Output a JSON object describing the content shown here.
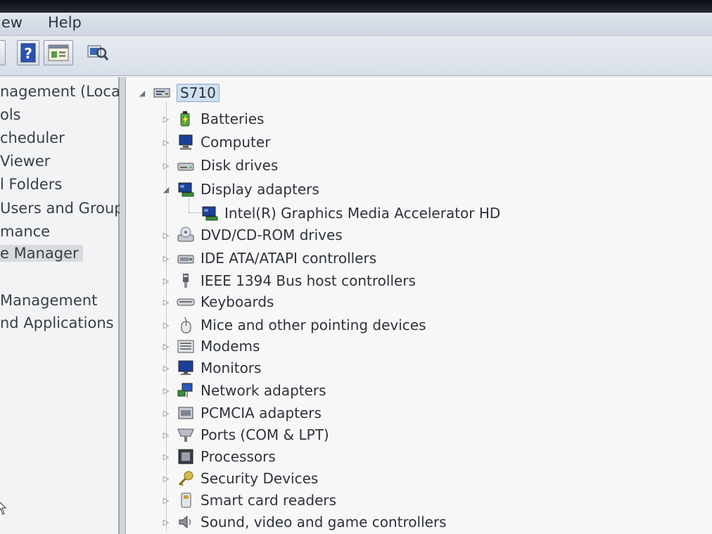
{
  "menu": [
    "View",
    "Help"
  ],
  "menu_visible": [
    "iew",
    "Help"
  ],
  "toolbar": {
    "buttons": [
      "help-icon",
      "console-icon",
      "scan-hardware-icon"
    ]
  },
  "left_tree": {
    "items": [
      {
        "text": "nagement (Local",
        "selected": false
      },
      {
        "text": "ols",
        "selected": false
      },
      {
        "text": "cheduler",
        "selected": false
      },
      {
        "text": "Viewer",
        "selected": false
      },
      {
        "text": "l Folders",
        "selected": false
      },
      {
        "text": "Users and Groups",
        "selected": false
      },
      {
        "text": "mance",
        "selected": false
      },
      {
        "text": "e Manager",
        "selected": true
      },
      {
        "text": "",
        "selected": false
      },
      {
        "text": "Management",
        "selected": false
      },
      {
        "text": "nd Applications",
        "selected": false
      }
    ]
  },
  "device_tree": {
    "root": {
      "label": "S710",
      "icon": "computer-root-icon",
      "expanded": true
    },
    "categories": [
      {
        "label": "Batteries",
        "icon": "battery-icon",
        "expanded": false
      },
      {
        "label": "Computer",
        "icon": "computer-icon",
        "expanded": false
      },
      {
        "label": "Disk drives",
        "icon": "disk-drive-icon",
        "expanded": false
      },
      {
        "label": "Display adapters",
        "icon": "display-adapter-icon",
        "expanded": true,
        "children": [
          {
            "label": "Intel(R) Graphics Media Accelerator HD",
            "icon": "display-adapter-icon"
          }
        ]
      },
      {
        "label": "DVD/CD-ROM drives",
        "icon": "dvd-icon",
        "expanded": false
      },
      {
        "label": "IDE ATA/ATAPI controllers",
        "icon": "ide-controller-icon",
        "expanded": false
      },
      {
        "label": "IEEE 1394 Bus host controllers",
        "icon": "ieee1394-icon",
        "expanded": false
      },
      {
        "label": "Keyboards",
        "icon": "keyboard-icon",
        "expanded": false
      },
      {
        "label": "Mice and other pointing devices",
        "icon": "mouse-icon",
        "expanded": false
      },
      {
        "label": "Modems",
        "icon": "modem-icon",
        "expanded": false
      },
      {
        "label": "Monitors",
        "icon": "monitor-icon",
        "expanded": false
      },
      {
        "label": "Network adapters",
        "icon": "network-adapter-icon",
        "expanded": false
      },
      {
        "label": "PCMCIA adapters",
        "icon": "pcmcia-icon",
        "expanded": false
      },
      {
        "label": "Ports (COM & LPT)",
        "icon": "ports-icon",
        "expanded": false
      },
      {
        "label": "Processors",
        "icon": "processor-icon",
        "expanded": false
      },
      {
        "label": "Security Devices",
        "icon": "security-key-icon",
        "expanded": false
      },
      {
        "label": "Smart card readers",
        "icon": "smart-card-reader-icon",
        "expanded": false
      },
      {
        "label": "Sound, video and game controllers",
        "icon": "sound-icon",
        "expanded": false
      }
    ]
  },
  "colors": {
    "selection": "#cfe0f1",
    "selection_border": "#88a6c6",
    "pane_bg": "#f7f7f8"
  }
}
